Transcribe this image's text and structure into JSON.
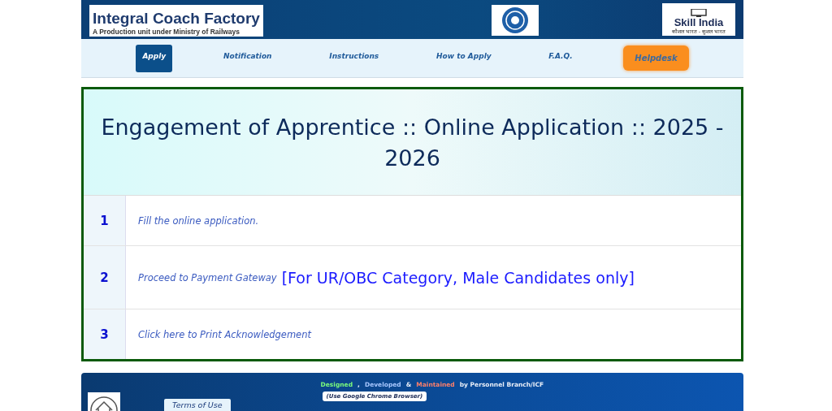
{
  "header": {
    "org_name": "Integral Coach Factory",
    "org_tagline": "A Production unit under Ministry of Railways",
    "skill_title": "Skill India",
    "skill_tagline": "कौशल भारत - कुशल भारत"
  },
  "nav": [
    {
      "label": "Apply",
      "selected": true,
      "kind": "tab"
    },
    {
      "label": "Notification",
      "selected": false,
      "kind": "tab"
    },
    {
      "label": "Instructions",
      "selected": false,
      "kind": "tab"
    },
    {
      "label": "How to Apply",
      "selected": false,
      "kind": "tab"
    },
    {
      "label": "F.A.Q.",
      "selected": false,
      "kind": "tab"
    },
    {
      "label": "Helpdesk",
      "selected": false,
      "kind": "helpdesk"
    }
  ],
  "main": {
    "title": "Engagement of Apprentice :: Online Application :: 2025 - 2026",
    "steps": [
      {
        "number": "1",
        "link": "Fill the online application."
      },
      {
        "number": "2",
        "link": "Proceed to Payment Gateway",
        "note": "[For UR/OBC Category, Male Candidates only]"
      },
      {
        "number": "3",
        "link": "Click here to Print Acknowledgement"
      }
    ]
  },
  "footer": {
    "credits": [
      {
        "text": "Designed",
        "color": "#7cfc7c"
      },
      {
        "text": ","
      },
      {
        "text": "Developed",
        "color": "#a8c8ff"
      },
      {
        "text": "&"
      },
      {
        "text": "Maintained",
        "color": "#ff7f6a"
      },
      {
        "text": "by Personnel Branch/ICF"
      }
    ],
    "browser_note": "(Use Google Chrome Browser)",
    "terms": "Terms of Use"
  }
}
